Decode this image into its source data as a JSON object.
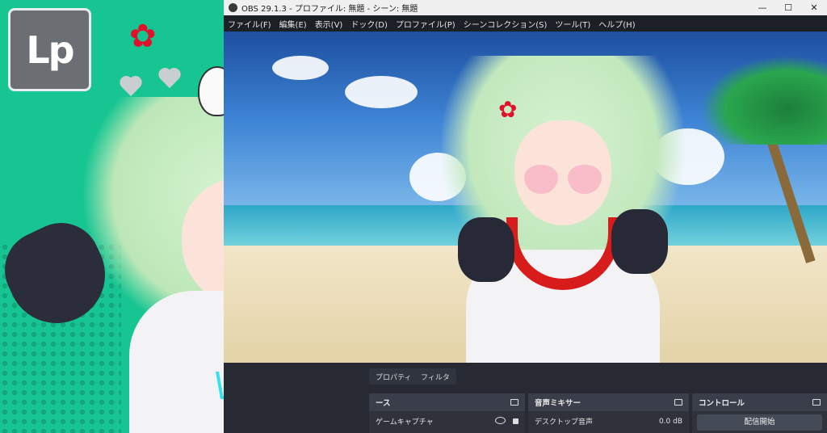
{
  "promo": {
    "logo_text": "Lp"
  },
  "obs": {
    "title": "OBS 29.1.3 - プロファイル: 無題 - シーン: 無題",
    "window_buttons": [
      "—",
      "☐",
      "✕"
    ],
    "menu": [
      "ファイル(F)",
      "編集(E)",
      "表示(V)",
      "ドック(D)",
      "プロファイル(P)",
      "シーンコレクション(S)",
      "ツール(T)",
      "ヘルプ(H)"
    ],
    "tabs": {
      "properties": "プロパティ",
      "filters": "フィルタ"
    },
    "sources": {
      "header": "ース",
      "item": "ゲームキャプチャ"
    },
    "mixer": {
      "header": "音声ミキサー",
      "channel": "デスクトップ音声",
      "level": "0.0 dB"
    },
    "controls": {
      "header": "コントロール",
      "start_stream": "配信開始"
    }
  },
  "colors": {
    "promo_bg": "#16c592",
    "obs_dark": "#272a33"
  }
}
